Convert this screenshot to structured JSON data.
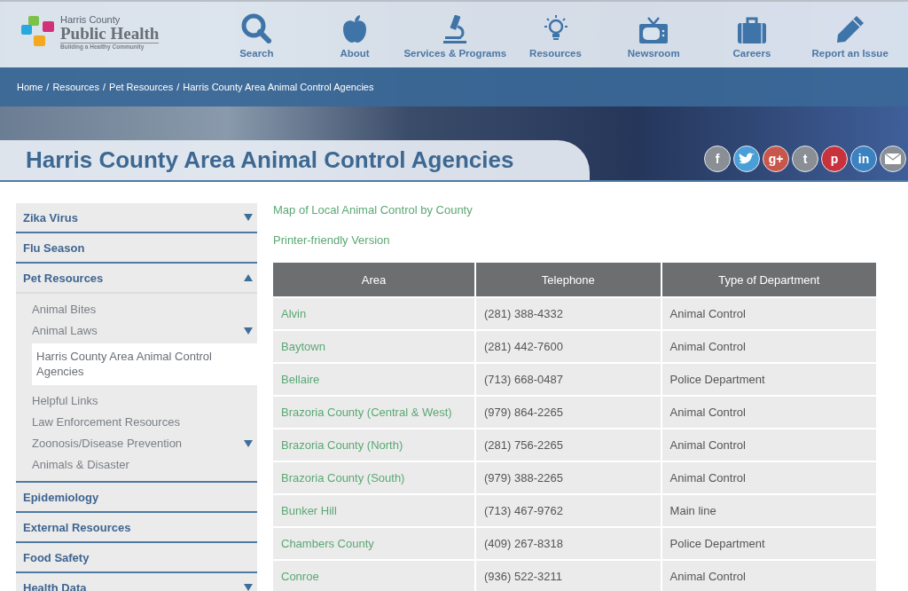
{
  "logo": {
    "small": "Harris County",
    "name": "Public Health",
    "tagline": "Building a Healthy Community"
  },
  "nav": [
    {
      "label": "Search"
    },
    {
      "label": "About"
    },
    {
      "label": "Services & Programs"
    },
    {
      "label": "Resources"
    },
    {
      "label": "Newsroom"
    },
    {
      "label": "Careers"
    },
    {
      "label": "Report an Issue"
    }
  ],
  "breadcrumb": [
    "Home",
    "Resources",
    "Pet Resources",
    "Harris County Area Animal Control Agencies"
  ],
  "breadcrumb_separator": "/",
  "page_title": "Harris County Area Animal Control Agencies",
  "social": [
    {
      "kind": "letter",
      "label": "f",
      "color": "#8a8f96"
    },
    {
      "kind": "bird",
      "color": "#4a9fd8"
    },
    {
      "kind": "letter",
      "label": "g+",
      "color": "#c9564a"
    },
    {
      "kind": "letter",
      "label": "t",
      "color": "#8a8f96"
    },
    {
      "kind": "letter",
      "label": "p",
      "color": "#c8323c"
    },
    {
      "kind": "letter",
      "label": "in",
      "color": "#3a82c0"
    },
    {
      "kind": "mail",
      "color": "#8a8f96"
    }
  ],
  "sidebar": {
    "items": [
      {
        "label": "Zika Virus",
        "expandable": true,
        "expanded": false
      },
      {
        "label": "Flu Season",
        "expandable": false,
        "expanded": false
      },
      {
        "label": "Pet Resources",
        "expandable": true,
        "expanded": true,
        "children": [
          {
            "label": "Animal Bites",
            "expandable": false,
            "selected": false
          },
          {
            "label": "Animal Laws",
            "expandable": true,
            "selected": false
          },
          {
            "label": "Harris County Area Animal Control Agencies",
            "expandable": false,
            "selected": true
          },
          {
            "label": "Helpful Links",
            "expandable": false,
            "selected": false
          },
          {
            "label": "Law Enforcement Resources",
            "expandable": false,
            "selected": false
          },
          {
            "label": "Zoonosis/Disease Prevention",
            "expandable": true,
            "selected": false
          },
          {
            "label": "Animals & Disaster",
            "expandable": false,
            "selected": false
          }
        ]
      },
      {
        "label": "Epidemiology",
        "expandable": false,
        "expanded": false
      },
      {
        "label": "External Resources",
        "expandable": false,
        "expanded": false
      },
      {
        "label": "Food Safety",
        "expandable": false,
        "expanded": false
      },
      {
        "label": "Health Data",
        "expandable": true,
        "expanded": false
      }
    ]
  },
  "links": [
    "Map of Local Animal Control by County",
    "Printer-friendly Version"
  ],
  "table": {
    "columns": [
      "Area",
      "Telephone",
      "Type of Department"
    ],
    "rows": [
      [
        "Alvin",
        "(281) 388-4332",
        "Animal Control"
      ],
      [
        "Baytown",
        "(281) 442-7600",
        "Animal Control"
      ],
      [
        "Bellaire",
        "(713) 668-0487",
        "Police Department"
      ],
      [
        "Brazoria County (Central & West)",
        "(979) 864-2265",
        "Animal Control"
      ],
      [
        "Brazoria County (North)",
        "(281) 756-2265",
        "Animal Control"
      ],
      [
        "Brazoria County (South)",
        "(979) 388-2265",
        "Animal Control"
      ],
      [
        "Bunker Hill",
        "(713) 467-9762",
        "Main line"
      ],
      [
        "Chambers County",
        "(409) 267-8318",
        "Police Department"
      ],
      [
        "Conroe",
        "(936) 522-3211",
        "Animal Control"
      ]
    ]
  }
}
